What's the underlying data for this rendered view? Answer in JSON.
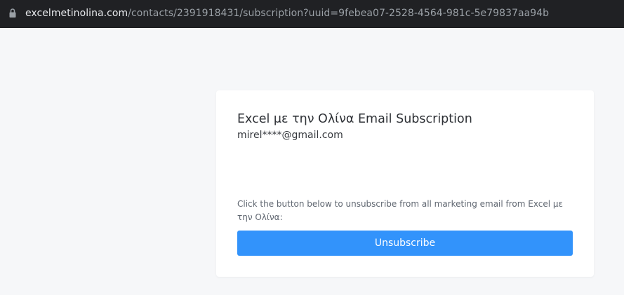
{
  "browser": {
    "url_host": "excelmetinolina.com",
    "url_path": "/contacts/2391918431/subscription?uuid=9febea07-2528-4564-981c-5e79837aa94b",
    "lock_icon": "lock-icon"
  },
  "card": {
    "title": "Excel με την Ολίνα Email Subscription",
    "email": "mirel****@gmail.com",
    "note": "Click the button below to unsubscribe from all marketing email from Excel με την Ολίνα:",
    "button_label": "Unsubscribe"
  },
  "colors": {
    "button": "#3293fb",
    "page_background": "#f6f7f9",
    "card_background": "#ffffff",
    "address_bar": "#202124"
  }
}
